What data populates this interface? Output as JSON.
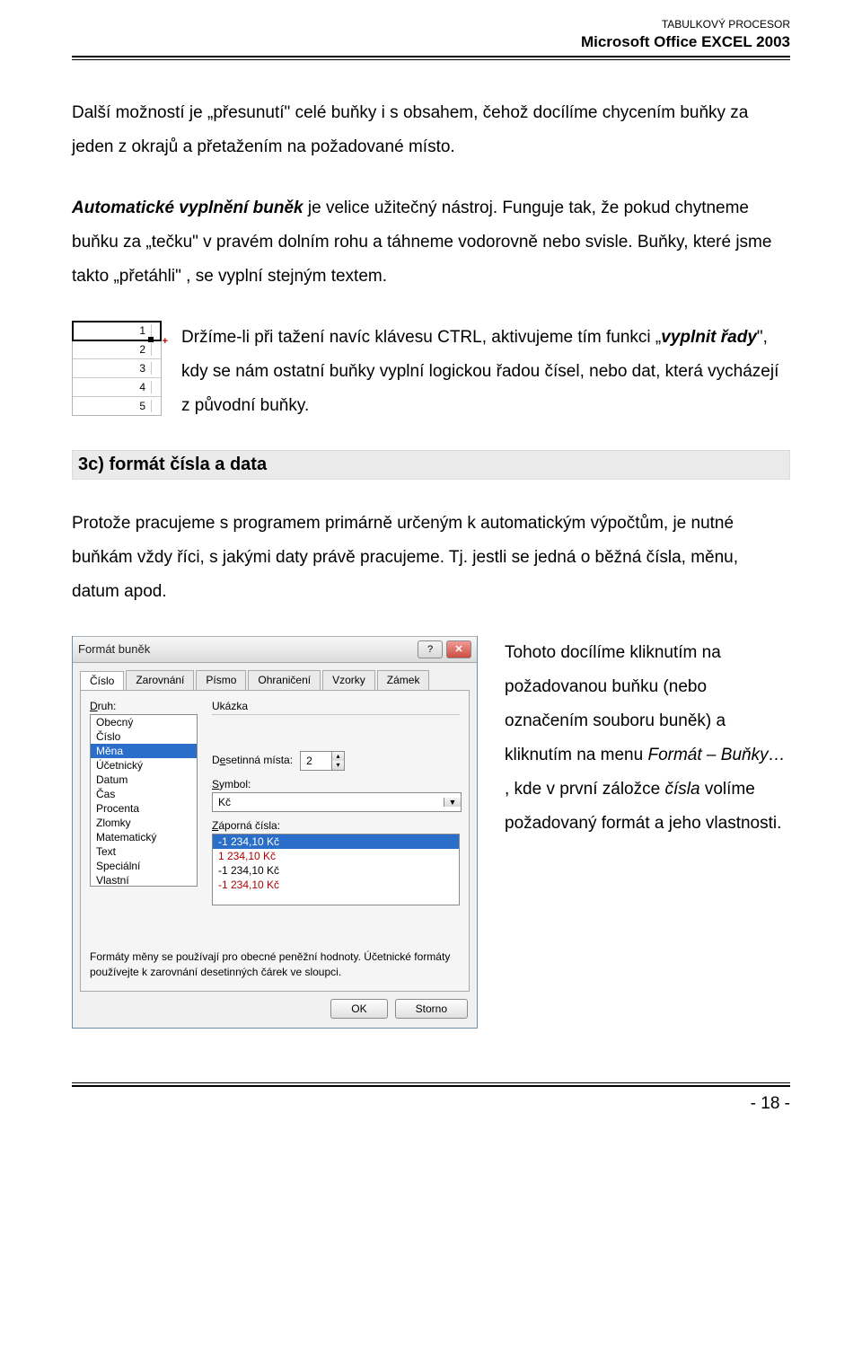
{
  "header": {
    "sub": "TABULKOVÝ PROCESOR",
    "main": "Microsoft Office EXCEL 2003"
  },
  "p1": {
    "t1": "Další možností je „přesunutí\" celé buňky i s obsahem, čehož docílíme chycením buňky za jeden z okrajů a přetažením na požadované místo."
  },
  "p2": {
    "lead": "Automatické vyplnění buněk",
    "rest": " je velice užitečný nástroj. Funguje tak, že pokud chytneme buňku za „tečku\" v pravém dolním rohu a táhneme vodorovně nebo svisle. Buňky, které jsme takto „přetáhli\" , se vyplní stejným textem."
  },
  "autofill": {
    "cells": [
      "1",
      "2",
      "3",
      "4",
      "5"
    ],
    "text_a": "Držíme-li při tažení navíc klávesu CTRL, aktivujeme tím funkci „",
    "text_b": "vyplnit řady",
    "text_c": "\", kdy se nám ostatní buňky vyplní logickou řadou čísel, nebo dat, která vycházejí z původní buňky."
  },
  "section": {
    "title": "3c) formát čísla a data"
  },
  "p3": {
    "t": "Protože pracujeme s programem primárně určeným k automatickým výpočtům, je nutné buňkám vždy říci, s jakými daty právě pracujeme. Tj. jestli se jedná o běžná čísla, měnu, datum apod."
  },
  "dialog": {
    "title": "Formát buněk",
    "tabs": [
      "Číslo",
      "Zarovnání",
      "Písmo",
      "Ohraničení",
      "Vzorky",
      "Zámek"
    ],
    "druh_label": "Druh:",
    "druh_options": [
      "Obecný",
      "Číslo",
      "Měna",
      "Účetnický",
      "Datum",
      "Čas",
      "Procenta",
      "Zlomky",
      "Matematický",
      "Text",
      "Speciální",
      "Vlastní"
    ],
    "druh_selected": "Měna",
    "sample_label": "Ukázka",
    "decimal_label": "Desetinná místa:",
    "decimal_value": "2",
    "symbol_label": "Symbol:",
    "symbol_value": "Kč",
    "neg_label": "Záporná čísla:",
    "neg_options": [
      "-1 234,10 Kč",
      "1 234,10 Kč",
      "-1 234,10 Kč",
      "-1 234,10 Kč"
    ],
    "help_text": "Formáty měny se používají pro obecné peněžní hodnoty. Účetnické formáty používejte k zarovnání desetinných čárek ve sloupci.",
    "ok": "OK",
    "cancel": "Storno"
  },
  "side": {
    "a": "Tohoto docílíme kliknutím na požadovanou buňku (nebo označením souboru buněk) a kliknutím na menu ",
    "b": "Formát – Buňky…",
    "c": " , kde v první záložce ",
    "d": "čísla",
    "e": " volíme požadovaný formát a jeho vlastnosti."
  },
  "footer": {
    "page": "- 18 -"
  }
}
